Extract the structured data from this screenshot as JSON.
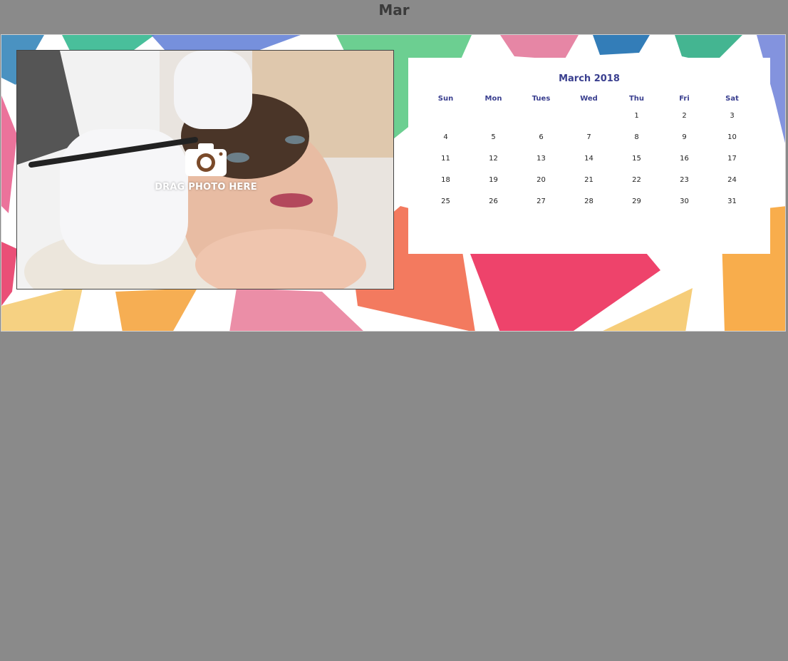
{
  "header": {
    "month_label": "Mar"
  },
  "photo_slot": {
    "hint_label": "DRAG PHOTO HERE",
    "icon": "camera-icon"
  },
  "calendar": {
    "title": "March 2018",
    "weekdays": [
      "Sun",
      "Mon",
      "Tues",
      "Wed",
      "Thu",
      "Fri",
      "Sat"
    ],
    "weeks": [
      [
        "",
        "",
        "",
        "",
        "1",
        "2",
        "3"
      ],
      [
        "4",
        "5",
        "6",
        "7",
        "8",
        "9",
        "10"
      ],
      [
        "11",
        "12",
        "13",
        "14",
        "15",
        "16",
        "17"
      ],
      [
        "18",
        "19",
        "20",
        "21",
        "22",
        "23",
        "24"
      ],
      [
        "25",
        "26",
        "27",
        "28",
        "29",
        "30",
        "31"
      ]
    ]
  },
  "colors": {
    "workspace_bg": "#8a8a8a",
    "calendar_title": "#3a3f8f",
    "weekday_label": "#3a3f8f"
  }
}
